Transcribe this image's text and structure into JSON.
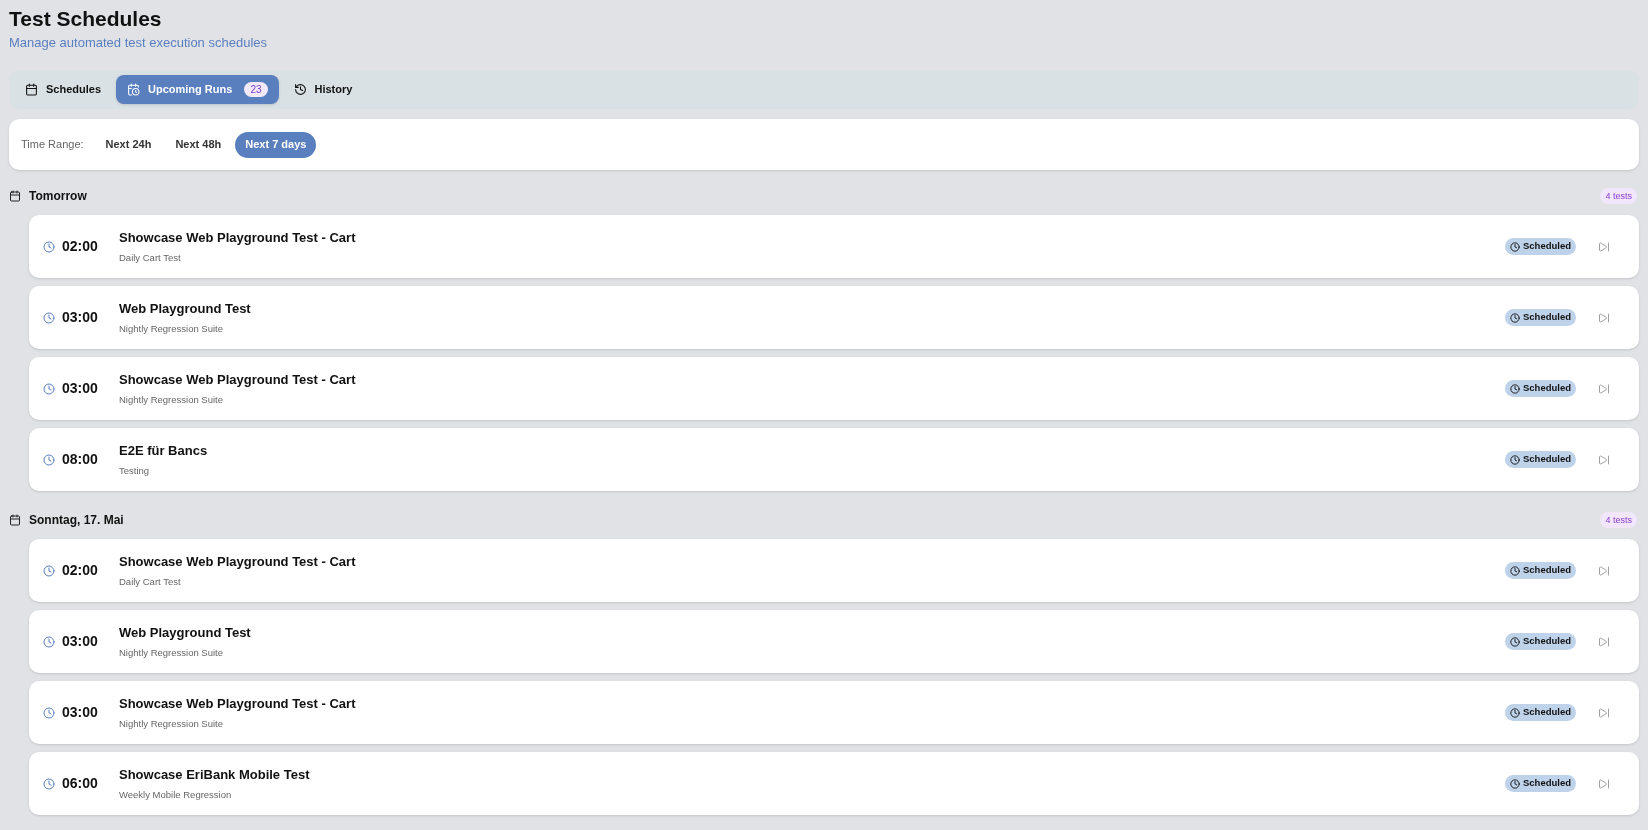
{
  "header": {
    "title": "Test Schedules",
    "subtitle": "Manage automated test execution schedules"
  },
  "tabs": [
    {
      "label": "Schedules",
      "selected": false
    },
    {
      "label": "Upcoming Runs",
      "selected": true,
      "count": "23"
    },
    {
      "label": "History",
      "selected": false
    }
  ],
  "time_range": {
    "label": "Time Range:",
    "options": [
      {
        "label": "Next 24h",
        "selected": false
      },
      {
        "label": "Next 48h",
        "selected": false
      },
      {
        "label": "Next 7 days",
        "selected": true
      }
    ]
  },
  "groups": [
    {
      "title": "Tomorrow",
      "count": "4 tests",
      "runs": [
        {
          "time": "02:00",
          "name": "Showcase Web Playground Test - Cart",
          "schedule": "Daily Cart Test",
          "status": "Scheduled"
        },
        {
          "time": "03:00",
          "name": "Web Playground Test",
          "schedule": "Nightly Regression Suite",
          "status": "Scheduled"
        },
        {
          "time": "03:00",
          "name": "Showcase Web Playground Test - Cart",
          "schedule": "Nightly Regression Suite",
          "status": "Scheduled"
        },
        {
          "time": "08:00",
          "name": "E2E für Bancs",
          "schedule": "Testing",
          "status": "Scheduled"
        }
      ]
    },
    {
      "title": "Sonntag, 17. Mai",
      "count": "4 tests",
      "runs": [
        {
          "time": "02:00",
          "name": "Showcase Web Playground Test - Cart",
          "schedule": "Daily Cart Test",
          "status": "Scheduled"
        },
        {
          "time": "03:00",
          "name": "Web Playground Test",
          "schedule": "Nightly Regression Suite",
          "status": "Scheduled"
        },
        {
          "time": "03:00",
          "name": "Showcase Web Playground Test - Cart",
          "schedule": "Nightly Regression Suite",
          "status": "Scheduled"
        },
        {
          "time": "06:00",
          "name": "Showcase EriBank Mobile Test",
          "schedule": "Weekly Mobile Regression",
          "status": "Scheduled"
        }
      ]
    }
  ]
}
